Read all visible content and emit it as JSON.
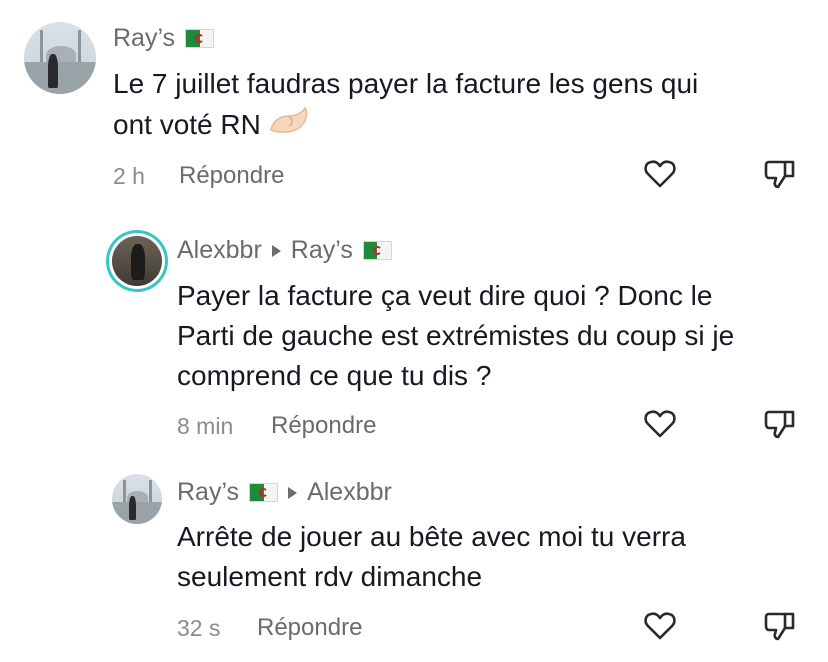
{
  "comments": [
    {
      "username": "Ray’s",
      "text_line1": "Le 7 juillet faudras payer la facture les gens qui",
      "text_line2": "ont voté RN",
      "emoji": "pinching-hand-emoji",
      "time": "2 h",
      "reply_label": "Répondre"
    },
    {
      "username": "Alexbbr",
      "reply_to": "Ray’s",
      "text_line1": "Payer la facture ça veut dire quoi ? Donc le",
      "text_line2": "Parti de gauche est extrémistes du coup si je",
      "text_line3": "comprend ce que tu dis ?",
      "time": "8 min",
      "reply_label": "Répondre"
    },
    {
      "username": "Ray’s",
      "reply_to": "Alexbbr",
      "text_line1": "Arrête de jouer au bête avec moi tu verra",
      "text_line2": "seulement rdv dimanche",
      "time": "32 s",
      "reply_label": "Répondre"
    }
  ],
  "icons": {
    "like": "heart-icon",
    "dislike": "thumbs-down-icon",
    "flag": "algeria-flag-icon",
    "reply_arrow": "triangle-right-icon"
  },
  "colors": {
    "text": "#161823",
    "muted": "#8a8b91",
    "username": "#6b6b6f",
    "ring": "#35c6c6"
  }
}
